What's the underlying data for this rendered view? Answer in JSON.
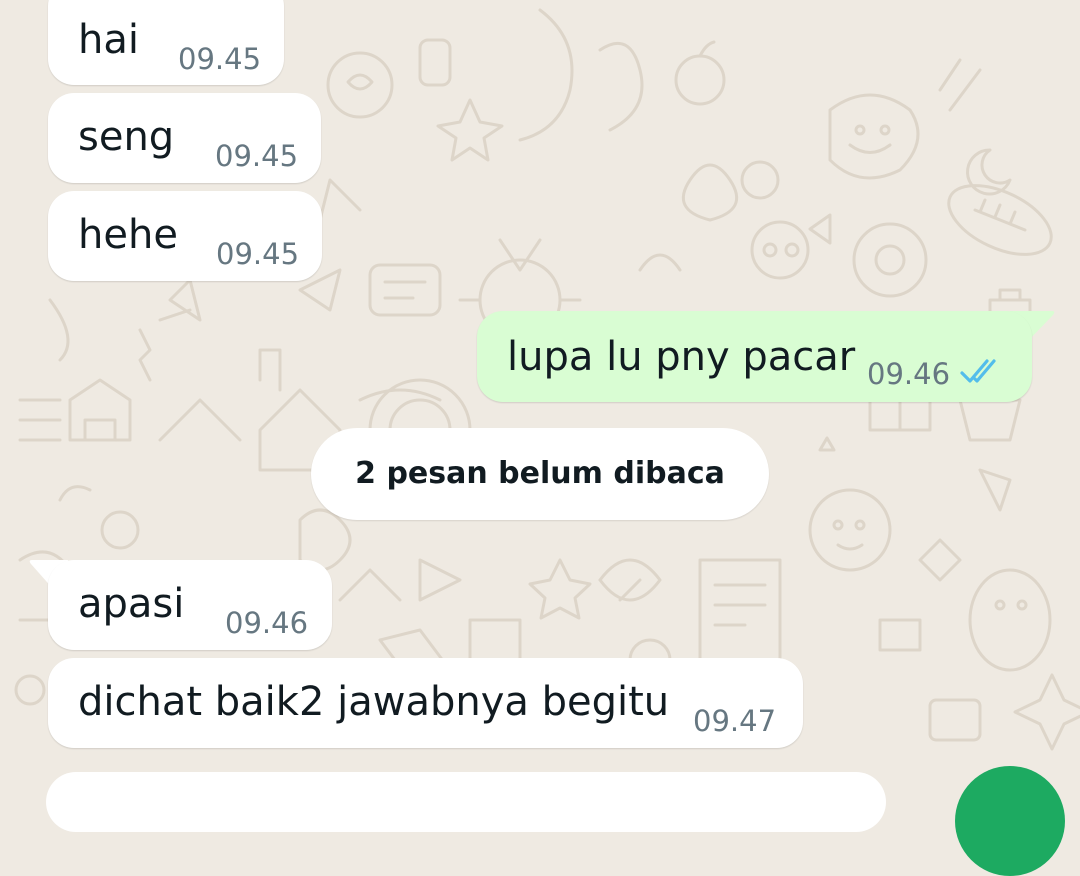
{
  "conversation": {
    "received_top": [
      {
        "text": "hai",
        "time": "09.45"
      },
      {
        "text": "seng",
        "time": "09.45"
      },
      {
        "text": "hehe",
        "time": "09.45"
      }
    ],
    "sent": {
      "text": "lupa lu pny pacar",
      "time": "09.46",
      "status_icon": "double-check-read-icon"
    },
    "unread_banner": "2 pesan belum dibaca",
    "received_bottom": [
      {
        "text": "apasi",
        "time": "09.46"
      },
      {
        "text": "dichat baik2 jawabnya begitu",
        "time": "09.47"
      }
    ]
  },
  "colors": {
    "wallpaper": "#efeae2",
    "incoming_bubble": "#ffffff",
    "outgoing_bubble": "#d9fdd3",
    "timestamp": "#667781",
    "read_ticks": "#53bdeb",
    "accent_green": "#1daa61"
  }
}
